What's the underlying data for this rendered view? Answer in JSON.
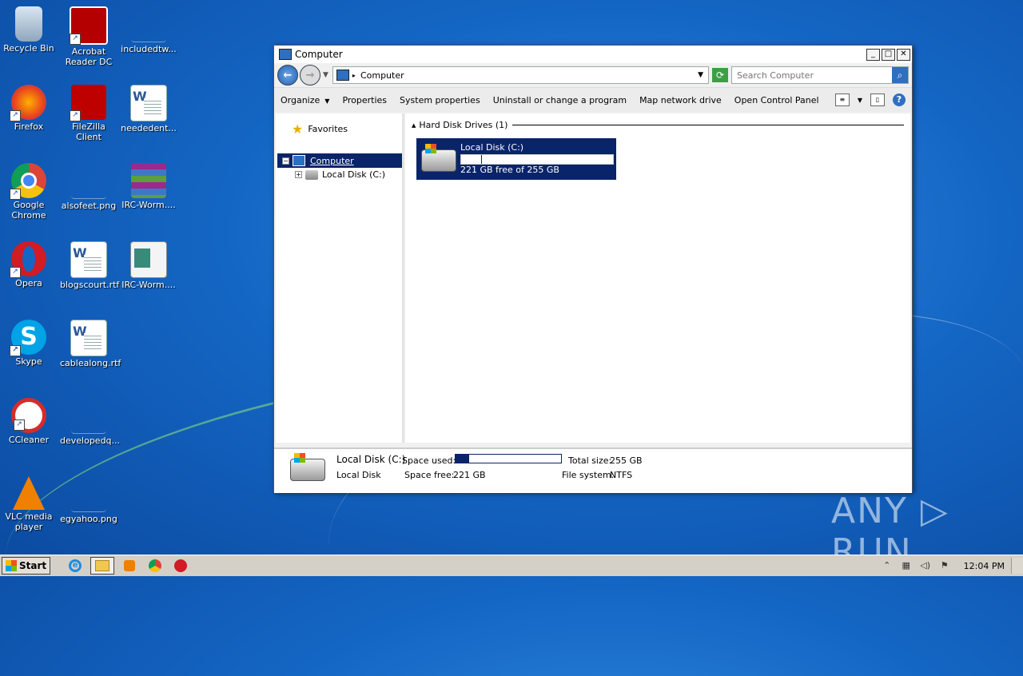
{
  "desktop": {
    "icons": [
      {
        "label": "Recycle Bin"
      },
      {
        "label": "Acrobat Reader DC"
      },
      {
        "label": "includedtw..."
      },
      {
        "label": "Firefox"
      },
      {
        "label": "FileZilla Client"
      },
      {
        "label": "neededent..."
      },
      {
        "label": "Google Chrome"
      },
      {
        "label": "alsofeet.png"
      },
      {
        "label": "IRC-Worm...."
      },
      {
        "label": "Opera"
      },
      {
        "label": "blogscourt.rtf"
      },
      {
        "label": "IRC-Worm...."
      },
      {
        "label": "Skype"
      },
      {
        "label": "cablealong.rtf"
      },
      {
        "label": "CCleaner"
      },
      {
        "label": "developedq..."
      },
      {
        "label": "VLC media player"
      },
      {
        "label": "egyahoo.png"
      }
    ],
    "watermark": "ANY ▷ RUN"
  },
  "window": {
    "title": "Computer",
    "address": {
      "path": "Computer"
    },
    "search": {
      "placeholder": "Search Computer"
    },
    "toolbar": {
      "organize": "Organize",
      "properties": "Properties",
      "system_properties": "System properties",
      "uninstall": "Uninstall or change a program",
      "map_drive": "Map network drive",
      "control_panel": "Open Control Panel"
    },
    "nav": {
      "favorites": "Favorites",
      "computer": "Computer",
      "local_disk": "Local Disk (C:)"
    },
    "content": {
      "group_title": "Hard Disk Drives (1)",
      "drive": {
        "name": "Local Disk (C:)",
        "free_text": "221 GB free of 255 GB",
        "used_fraction": 0.13
      }
    },
    "details": {
      "name": "Local Disk (C:)",
      "type": "Local Disk",
      "space_used_label": "Space used:",
      "space_free_label": "Space free:",
      "space_free_value": "221 GB",
      "total_size_label": "Total size:",
      "total_size_value": "255 GB",
      "file_system_label": "File system:",
      "file_system_value": "NTFS"
    }
  },
  "taskbar": {
    "start_label": "Start",
    "clock": "12:04 PM"
  }
}
